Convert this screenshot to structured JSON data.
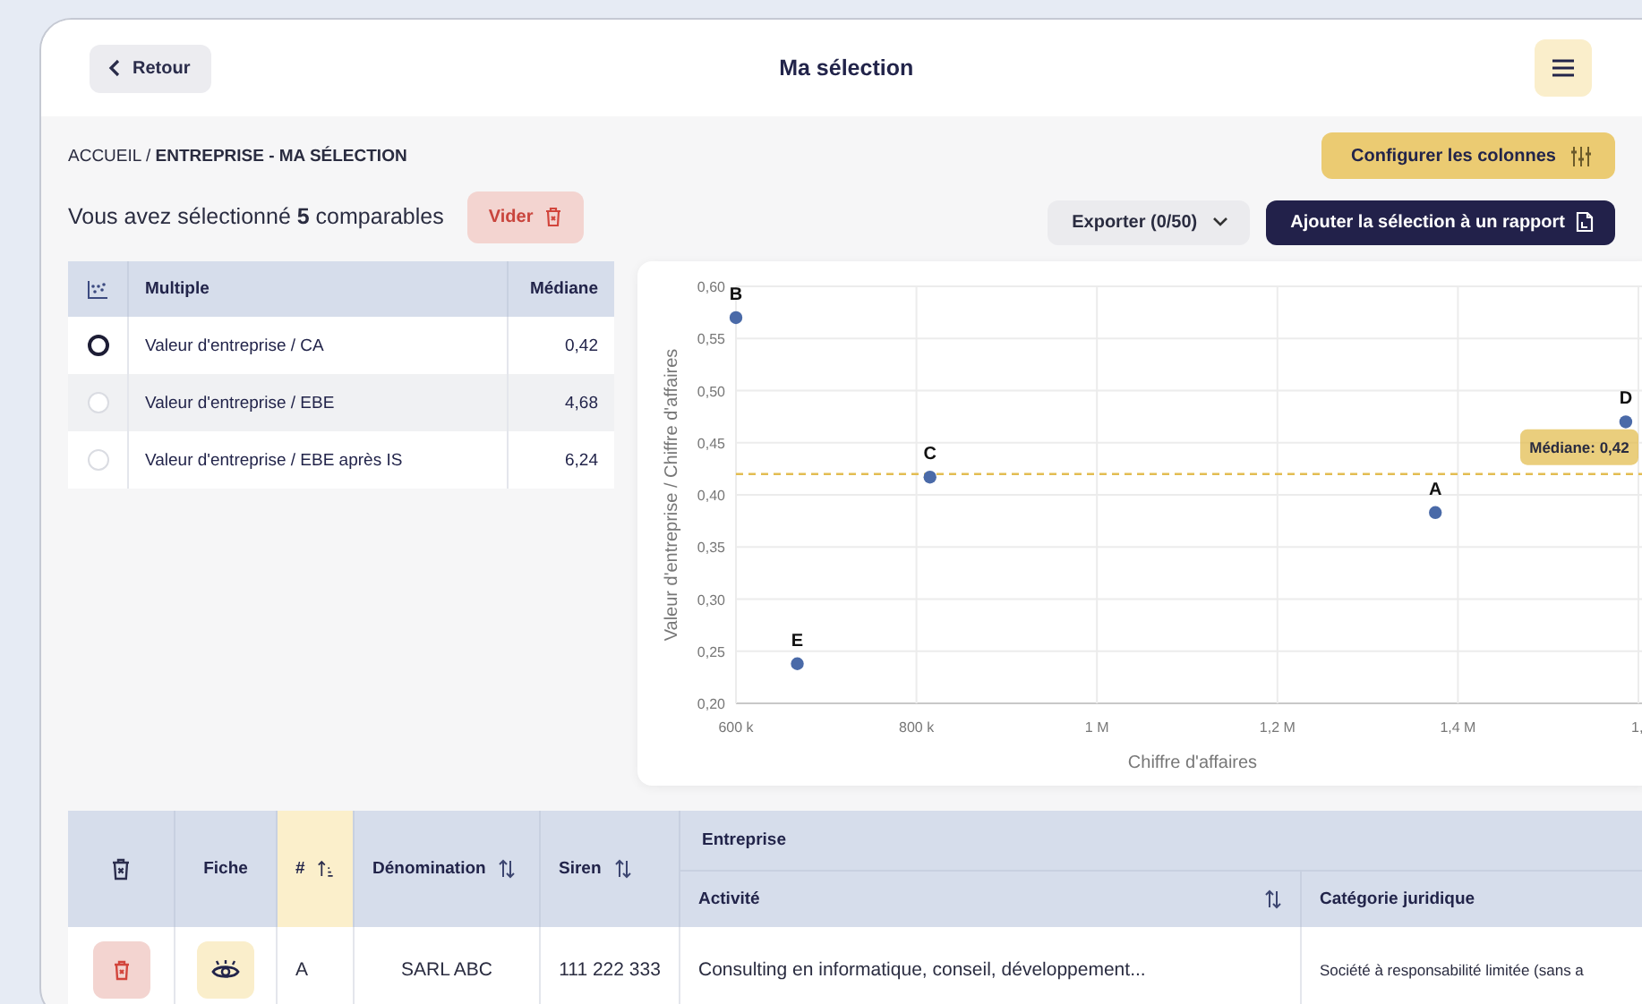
{
  "header": {
    "back_label": "Retour",
    "title": "Ma sélection"
  },
  "breadcrumb": "ACCUEIL / **ENTREPRISE - MA SÉLECTION**",
  "configure_button": "Configurer les colonnes",
  "selection_summary": "Vous avez sélectionné **5** comparables",
  "clear_button": "Vider",
  "export_button": "Exporter (0/50)",
  "add_to_report_button": "Ajouter la sélection à un rapport",
  "multiples_table": {
    "columns": [
      "Multiple",
      "Médiane"
    ],
    "rows": [
      {
        "multiple": "Valeur d'entreprise / CA",
        "median": "0,42",
        "selected": true
      },
      {
        "multiple": "Valeur d'entreprise / EBE",
        "median": "4,68",
        "selected": false
      },
      {
        "multiple": "Valeur d'entreprise / EBE après IS",
        "median": "6,24",
        "selected": false
      }
    ]
  },
  "chart": {
    "clipped_tick_label": "1,",
    "chart_data": {
      "type": "scatter",
      "grid": true,
      "xlabel": "Chiffre d'affaires",
      "ylabel": "Valeur d'entreprise / Chiffre d'affaires",
      "x": [
        1375000,
        600000,
        815000,
        1586000,
        668000
      ],
      "series": [
        {
          "color": "#4a6aa8",
          "values": [
            0.383,
            0.57,
            0.417,
            0.47,
            0.238
          ]
        }
      ],
      "value_labels": [
        "A",
        "B",
        "C",
        "D",
        "E"
      ],
      "xlim": [
        600000,
        1600000
      ],
      "ylim": [
        0.2,
        0.6
      ],
      "xticks": [
        {
          "value": 600000,
          "label": "600 k"
        },
        {
          "value": 800000,
          "label": "800 k"
        },
        {
          "value": 1000000,
          "label": "1 M"
        },
        {
          "value": 1200000,
          "label": "1,2 M"
        },
        {
          "value": 1400000,
          "label": "1,4 M"
        }
      ],
      "yticks": [
        {
          "value": 0.2,
          "label": "0,20"
        },
        {
          "value": 0.25,
          "label": "0,25"
        },
        {
          "value": 0.3,
          "label": "0,30"
        },
        {
          "value": 0.35,
          "label": "0,35"
        },
        {
          "value": 0.4,
          "label": "0,40"
        },
        {
          "value": 0.45,
          "label": "0,45"
        },
        {
          "value": 0.5,
          "label": "0,50"
        },
        {
          "value": 0.55,
          "label": "0,55"
        },
        {
          "value": 0.6,
          "label": "0,60"
        }
      ],
      "ref_lines": [
        {
          "axis": "y",
          "value": 0.42,
          "label": "Médiane: 0,42",
          "color": "#e3bd52"
        }
      ]
    }
  },
  "comparables_table": {
    "group_header": "Entreprise",
    "columns": [
      {
        "kind": "delete",
        "sortable": false,
        "sorted": false
      },
      {
        "kind": "text",
        "label": "Fiche",
        "sortable": false,
        "sorted": false
      },
      {
        "kind": "text",
        "label": "#",
        "sortable": true,
        "sorted": true
      },
      {
        "kind": "text",
        "label": "Dénomination",
        "sortable": true,
        "sorted": false
      },
      {
        "kind": "text",
        "label": "Siren",
        "sortable": true,
        "sorted": false
      },
      {
        "kind": "text",
        "label": "Activité",
        "sortable": true,
        "sorted": false
      },
      {
        "kind": "text",
        "label": "Catégorie juridique",
        "sortable": false,
        "sorted": false
      }
    ],
    "rows": [
      {
        "letter": "A",
        "name": "SARL ABC",
        "siren": "111 222 333",
        "activity": "Consulting en informatique, conseil, développement...",
        "legal_category": "Société à responsabilité limitée (sans a"
      }
    ]
  }
}
